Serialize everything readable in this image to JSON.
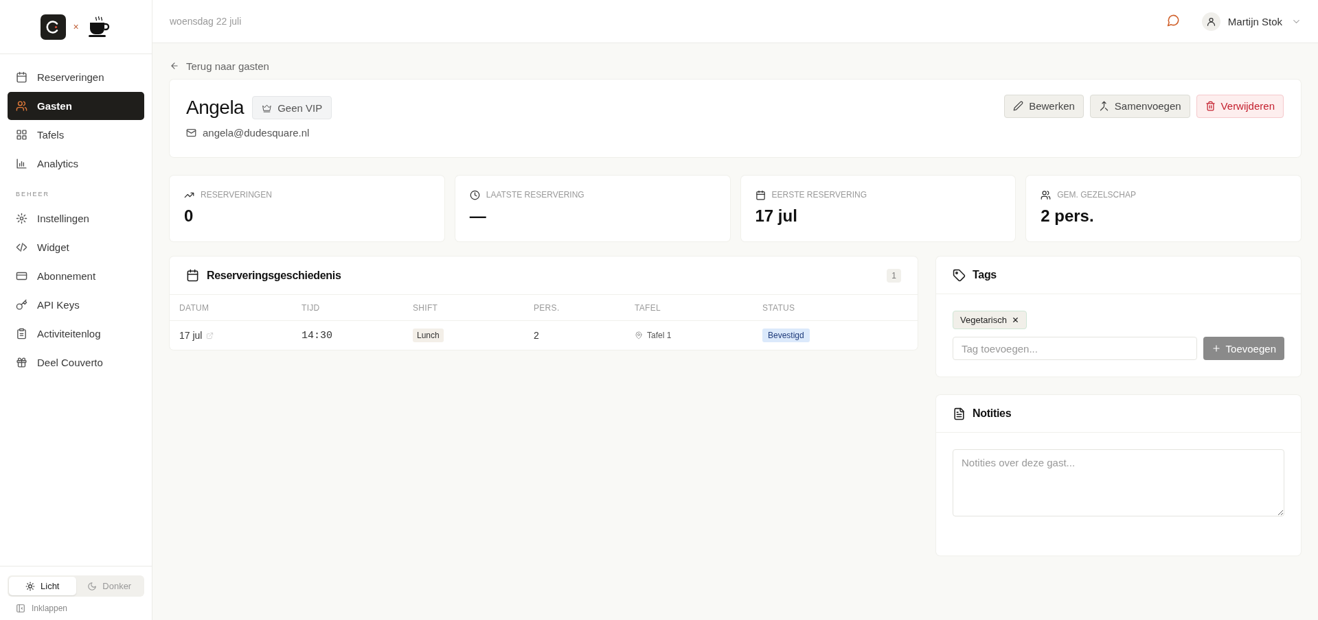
{
  "sidebar": {
    "logo_separator": "×",
    "nav_items": [
      {
        "label": "Reserveringen",
        "selected": false
      },
      {
        "label": "Gasten",
        "selected": true
      },
      {
        "label": "Tafels",
        "selected": false
      },
      {
        "label": "Analytics",
        "selected": false
      }
    ],
    "section_label": "BEHEER",
    "manage_items": [
      {
        "label": "Instellingen",
        "selected": false
      },
      {
        "label": "Widget",
        "selected": false
      },
      {
        "label": "Abonnement",
        "selected": false
      },
      {
        "label": "API Keys",
        "selected": false
      },
      {
        "label": "Activiteitenlog",
        "selected": false
      },
      {
        "label": "Deel Couverto",
        "selected": false
      }
    ],
    "theme_options": [
      {
        "label": "Licht",
        "selected": true
      },
      {
        "label": "Donker",
        "selected": false
      }
    ],
    "collapse": "Inklappen"
  },
  "header": {
    "date": "woensdag 22 juli",
    "user": "Martijn Stok"
  },
  "back_link": "Terug naar gasten",
  "guest": {
    "name": "Angela",
    "vip_badge": "Geen VIP",
    "email": "angela@dudesquare.nl",
    "actions": [
      {
        "label": "Bewerken",
        "kind": "edit"
      },
      {
        "label": "Samenvoegen",
        "kind": "merge"
      },
      {
        "label": "Verwijderen",
        "kind": "delete"
      }
    ]
  },
  "stats": [
    {
      "label": "RESERVERINGEN",
      "value": "0"
    },
    {
      "label": "LAATSTE RESERVERING",
      "value": "—"
    },
    {
      "label": "EERSTE RESERVERING",
      "value": "17 jul"
    },
    {
      "label": "GEM. GEZELSCHAP",
      "value": "2 pers."
    }
  ],
  "history": {
    "title": "Reserveringsgeschiedenis",
    "count": "1",
    "columns": [
      "DATUM",
      "TIJD",
      "SHIFT",
      "PERS.",
      "TAFEL",
      "STATUS"
    ],
    "rows": [
      {
        "date": "17 jul",
        "time": "14:30",
        "shift": "Lunch",
        "persons": "2",
        "table": "Tafel 1",
        "status": "Bevestigd"
      }
    ]
  },
  "tags": {
    "title": "Tags",
    "items": [
      {
        "label": "Vegetarisch"
      }
    ],
    "placeholder": "Tag toevoegen...",
    "add_button": "Toevoegen"
  },
  "notes": {
    "title": "Notities",
    "placeholder": "Notities over deze gast..."
  }
}
